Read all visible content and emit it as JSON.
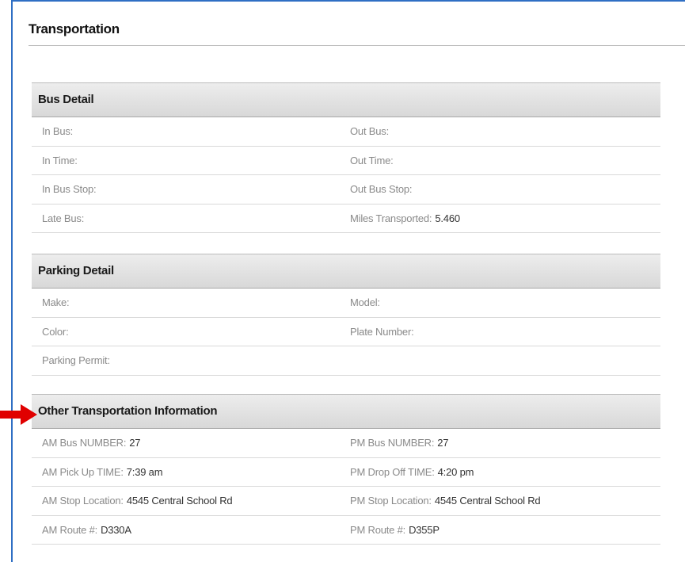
{
  "page": {
    "title": "Transportation"
  },
  "sections": [
    {
      "title": "Bus Detail",
      "rows": [
        [
          {
            "label": "In Bus:",
            "value": ""
          },
          {
            "label": "Out Bus:",
            "value": ""
          }
        ],
        [
          {
            "label": "In Time:",
            "value": ""
          },
          {
            "label": "Out Time:",
            "value": ""
          }
        ],
        [
          {
            "label": "In Bus Stop:",
            "value": ""
          },
          {
            "label": "Out Bus Stop:",
            "value": ""
          }
        ],
        [
          {
            "label": "Late Bus:",
            "value": ""
          },
          {
            "label": "Miles Transported:",
            "value": "5.460"
          }
        ]
      ]
    },
    {
      "title": "Parking Detail",
      "rows": [
        [
          {
            "label": "Make:",
            "value": ""
          },
          {
            "label": "Model:",
            "value": ""
          }
        ],
        [
          {
            "label": "Color:",
            "value": ""
          },
          {
            "label": "Plate Number:",
            "value": ""
          }
        ],
        [
          {
            "label": "Parking Permit:",
            "value": ""
          }
        ]
      ]
    },
    {
      "title": "Other Transportation Information",
      "rows": [
        [
          {
            "label": "AM Bus NUMBER:",
            "value": "27"
          },
          {
            "label": "PM Bus NUMBER:",
            "value": "27"
          }
        ],
        [
          {
            "label": "AM Pick Up TIME:",
            "value": "7:39 am"
          },
          {
            "label": "PM Drop Off TIME:",
            "value": "4:20 pm"
          }
        ],
        [
          {
            "label": "AM Stop Location:",
            "value": "4545 Central School Rd"
          },
          {
            "label": "PM Stop Location:",
            "value": "4545 Central School Rd"
          }
        ],
        [
          {
            "label": "AM Route #:",
            "value": "D330A"
          },
          {
            "label": "PM Route #:",
            "value": "D355P"
          }
        ]
      ]
    }
  ],
  "annotation": {
    "arrow_icon": "red-arrow-right-icon",
    "color": "#e00000"
  },
  "colors": {
    "frame_border": "#2f6fc4",
    "header_bg": "#dcdcdc",
    "label": "#8a8a8a",
    "value": "#333333"
  }
}
